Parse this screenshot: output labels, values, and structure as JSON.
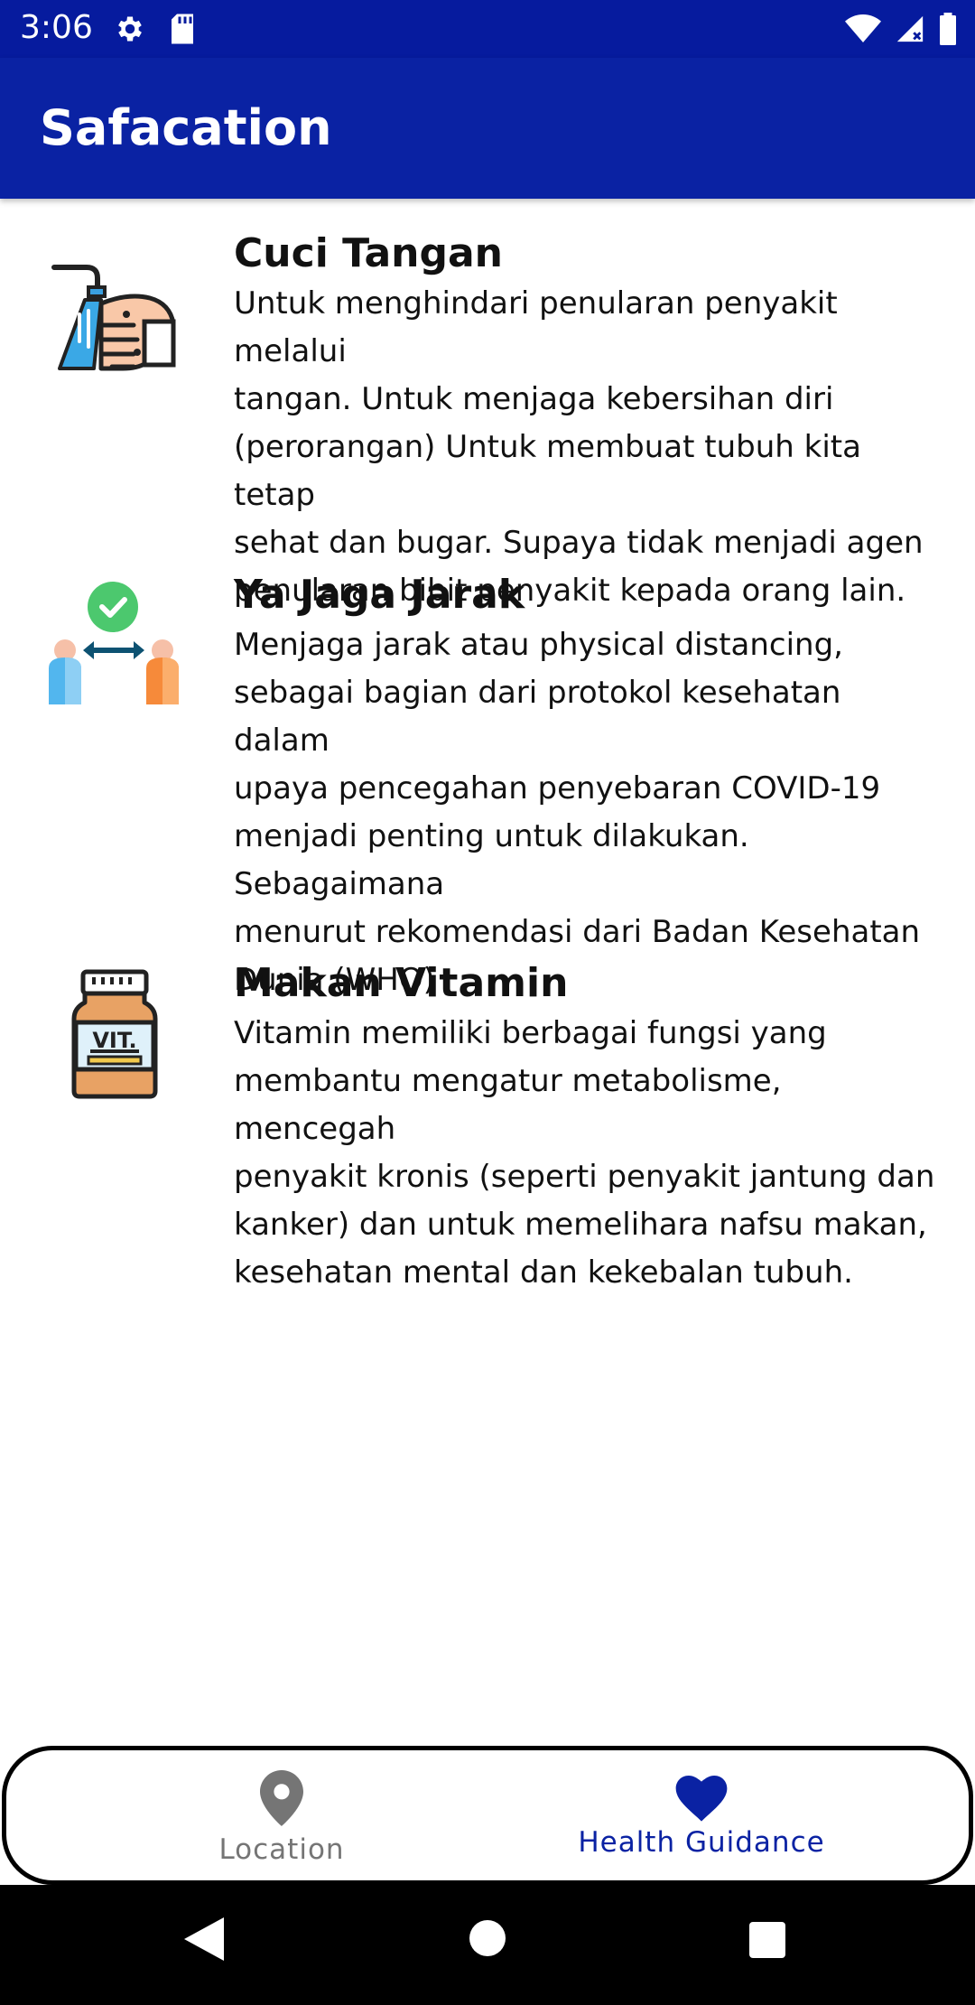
{
  "status_bar": {
    "time": "3:06",
    "left_icons": [
      "gear-icon",
      "sd-card-icon"
    ],
    "right_icons": [
      "wifi-icon",
      "signal-icon",
      "battery-icon"
    ]
  },
  "app_bar": {
    "title": "Safacation"
  },
  "guides": [
    {
      "title": "Cuci Tangan",
      "icon": "hand-washing-icon",
      "lines": [
        "Untuk menghindari penularan penyakit melalui",
        "tangan. Untuk menjaga kebersihan diri",
        "(perorangan) Untuk membuat tubuh kita tetap",
        "sehat dan bugar. Supaya tidak menjadi agen",
        "penularan bibit penyakit kepada orang lain."
      ]
    },
    {
      "title": "Ya Jaga Jarak",
      "icon": "social-distancing-icon",
      "lines": [
        "Menjaga jarak atau physical distancing,",
        "sebagai bagian dari protokol kesehatan dalam",
        "upaya pencegahan penyebaran COVID-19",
        "menjadi penting untuk dilakukan. Sebagaimana",
        "menurut rekomendasi dari Badan Kesehatan",
        "Dunia (WHO)"
      ]
    },
    {
      "title": "Makan Vitamin",
      "icon": "vitamin-bottle-icon",
      "icon_text": "VIT.",
      "lines": [
        "Vitamin memiliki berbagai fungsi yang",
        "membantu mengatur metabolisme, mencegah",
        "penyakit kronis (seperti penyakit jantung dan",
        "kanker) dan untuk memelihara nafsu makan,",
        "kesehatan mental dan kekebalan tubuh."
      ]
    }
  ],
  "bottom_nav": {
    "items": [
      {
        "label": "Location",
        "icon": "location-pin-icon",
        "active": false
      },
      {
        "label": "Health Guidance",
        "icon": "heart-icon",
        "active": true
      }
    ]
  },
  "colors": {
    "status_bar": "#061b9e",
    "app_bar": "#0a22a3",
    "active": "#0a22a3",
    "inactive": "#757575"
  }
}
